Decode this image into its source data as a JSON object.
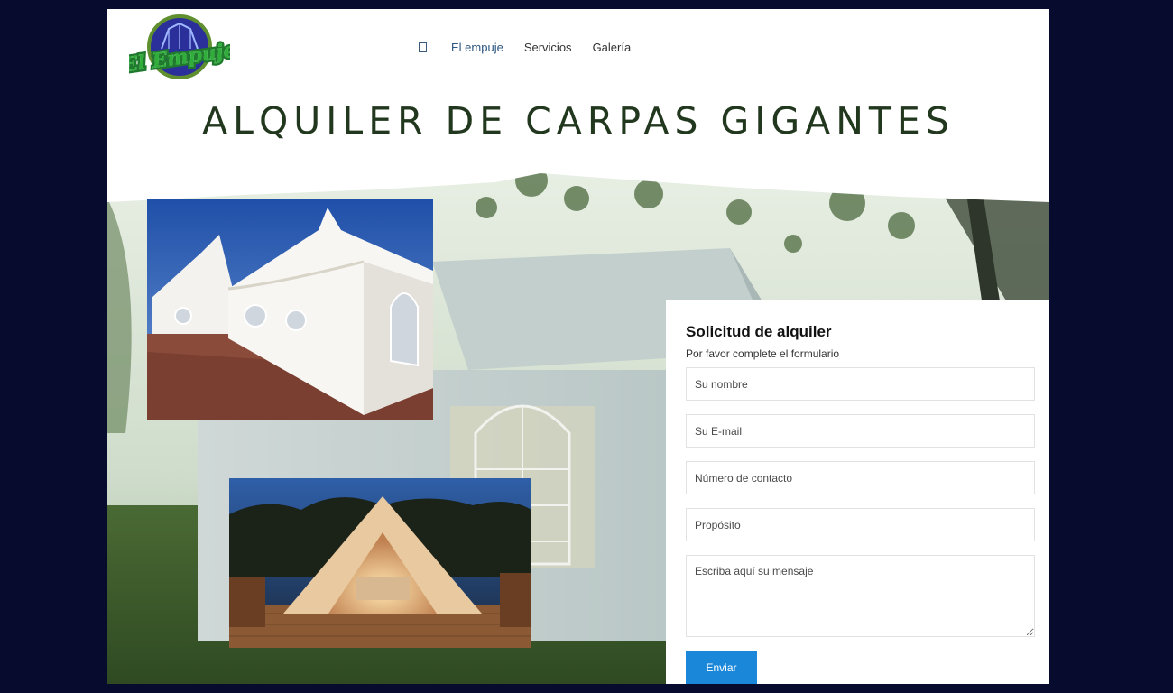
{
  "brand": {
    "logo_text": "El Empuje"
  },
  "nav": {
    "items": [
      {
        "label": "El empuje",
        "active": true
      },
      {
        "label": "Servicios",
        "active": false
      },
      {
        "label": "Galería",
        "active": false
      }
    ]
  },
  "hero": {
    "headline": "ALQUILER DE CARPAS GIGANTES"
  },
  "form": {
    "title": "Solicitud de alquiler",
    "subtitle": "Por favor complete el formulario",
    "name_placeholder": "Su nombre",
    "email_placeholder": "Su E-mail",
    "phone_placeholder": "Número de contacto",
    "purpose_placeholder": "Propósito",
    "message_placeholder": "Escriba aquí su mensaje",
    "submit_label": "Enviar"
  },
  "colors": {
    "page_bg": "#070b2e",
    "headline": "#22381e",
    "nav_active": "#2c5580",
    "button": "#1a87d8"
  }
}
